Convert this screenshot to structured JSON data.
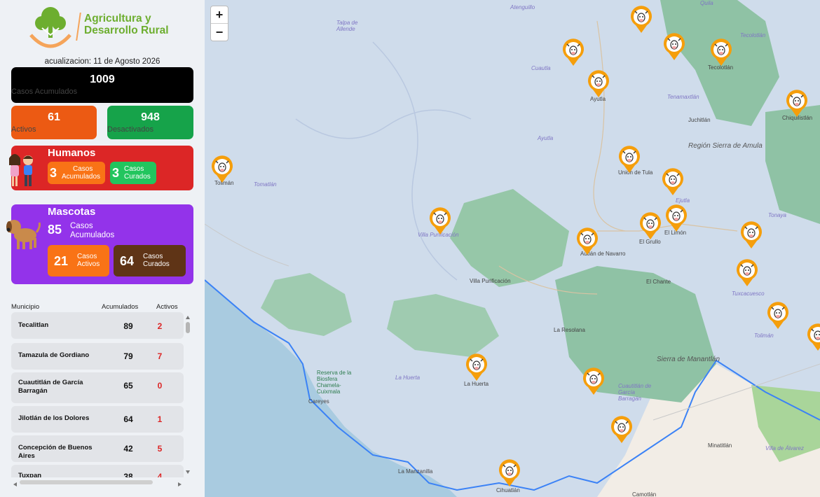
{
  "sidebar": {
    "logo_line1": "Agricultura y",
    "logo_line2": "Desarrollo Rural",
    "update": "acualizacion: 11 de Agosto 2026",
    "total": {
      "value": "1009",
      "label": "Casos Acumulados"
    },
    "activos": {
      "value": "61",
      "label": "Activos"
    },
    "desactivados": {
      "value": "948",
      "label": "Desactivados"
    },
    "humanos": {
      "title": "Humanos",
      "acum_value": "3",
      "acum_l1": "Casos",
      "acum_l2": "Acumulados",
      "cur_value": "3",
      "cur_l1": "Casos",
      "cur_l2": "Curados"
    },
    "mascotas": {
      "title": "Mascotas",
      "acum_value": "85",
      "acum_l1": "Casos",
      "acum_l2": "Acumulados",
      "act_value": "21",
      "act_l1": "Casos",
      "act_l2": "Activos",
      "cur_value": "64",
      "cur_l1": "Casos",
      "cur_l2": "Curados"
    },
    "table": {
      "headers": [
        "Municipio",
        "Acumulados",
        "Activos"
      ],
      "rows": [
        {
          "municipio": "Tecalitlan",
          "acumulados": "89",
          "activos": "2"
        },
        {
          "municipio": "Tamazula de Gordiano",
          "acumulados": "79",
          "activos": "7"
        },
        {
          "municipio": "Cuautitlán de García Barragán",
          "acumulados": "65",
          "activos": "0"
        },
        {
          "municipio": "Jilotlán de los Dolores",
          "acumulados": "64",
          "activos": "1"
        },
        {
          "municipio": "Concepción de Buenos Aires",
          "acumulados": "42",
          "activos": "5"
        },
        {
          "municipio": "Tuxpan",
          "acumulados": "38",
          "activos": "4"
        }
      ]
    }
  },
  "map": {
    "zoom_in": "+",
    "zoom_out": "−",
    "places": {
      "tolimán": "Tolimán",
      "ayutla": "Ayutla",
      "union_de_tula": "Unión de Tula",
      "tecolotlan": "Tecolotlán",
      "juchitlan": "Juchitlán",
      "chiquilistlan": "Chiquilistlán",
      "region_sierra": "Región Sierra de Amula",
      "el_grullo": "El Grullo",
      "el_limon": "El Limón",
      "autlan": "Autlán de Navarro",
      "el_chante": "El Chante",
      "villa_purificacion": "Villa Purificación",
      "villa_purificacion_it": "Villa Purificación",
      "tuxcacuesco": "Tuxcacuesco",
      "la_resolana": "La Resolana",
      "sierra_manantlan": "Sierra de Manantlán",
      "la_huerta": "La Huerta",
      "la_huerta_it": "La Huerta",
      "reserva": "Reserva de la Biosfera Chamela-Cuixmala",
      "careyes": "Careyes",
      "cuautitlan_it": "Cuautitlán de García Barragán",
      "minatitlan": "Minatitlán",
      "la_manzanilla": "La Manzanilla",
      "cihuatlan": "Cihuatlán",
      "camotlan": "Camotlán",
      "villa_alvarez": "Villa de Álvarez",
      "talpa": "Talpa de Allende",
      "atenguillo": "Atenguillo",
      "cuautla": "Cuautla",
      "tomatlan_it": "Tomatlán",
      "ayutla_it": "Ayutla",
      "ejutla": "Ejutla",
      "tonaya": "Tonaya",
      "tolimán_it": "Tolimán",
      "guila": "Quila",
      "tenamaxtlan": "Tenamaxtlán",
      "tecolotlan_it": "Tecolotlán"
    }
  }
}
